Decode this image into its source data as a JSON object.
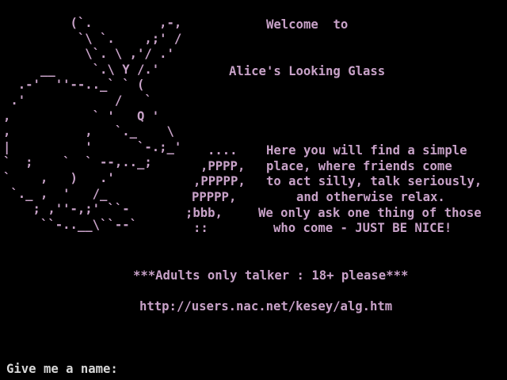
{
  "colors": {
    "background": "#000000",
    "text": "#c8a2c8",
    "prompt_text": "#d8d8d8"
  },
  "banner": {
    "art_lines": [
      "         (`.         ,-,",
      "          `\\ `.    ,;' /",
      "           \\`. \\ ,'/ .'",
      "     __     `.\\ Y /.'",
      "  .-'  ''--.._` ` (",
      " .'            /   `",
      ",           ` '   Q '",
      ",          ,   `._    \\",
      "|          '      `-.;_'",
      "`  ;    `  ` --,.._;",
      "`    ,   )   .'",
      " `._ ,  '   /_",
      "    ; ,''-,;' ``-",
      "     ``-..__\\``--`"
    ],
    "welcome": "Welcome  to",
    "name": "Alice's Looking Glass"
  },
  "intro": {
    "lines": [
      {
        "dots": "....",
        "text": "Here you will find a simple"
      },
      {
        "dots": ",PPPP,",
        "text": "place, where friends come"
      },
      {
        "dots": ",PPPPP,",
        "text": "to act silly, talk seriously,"
      },
      {
        "dots": "PPPPP,",
        "text": "and otherwise relax."
      },
      {
        "dots": ";bbb,",
        "text": "We only ask one thing of those"
      },
      {
        "dots": "::",
        "text": "who come - JUST BE NICE!"
      }
    ]
  },
  "notice": "***Adults only talker : 18+ please***",
  "url": "http://users.nac.net/kesey/alg.htm",
  "prompt": {
    "label": "Give me a name:",
    "value": ""
  }
}
